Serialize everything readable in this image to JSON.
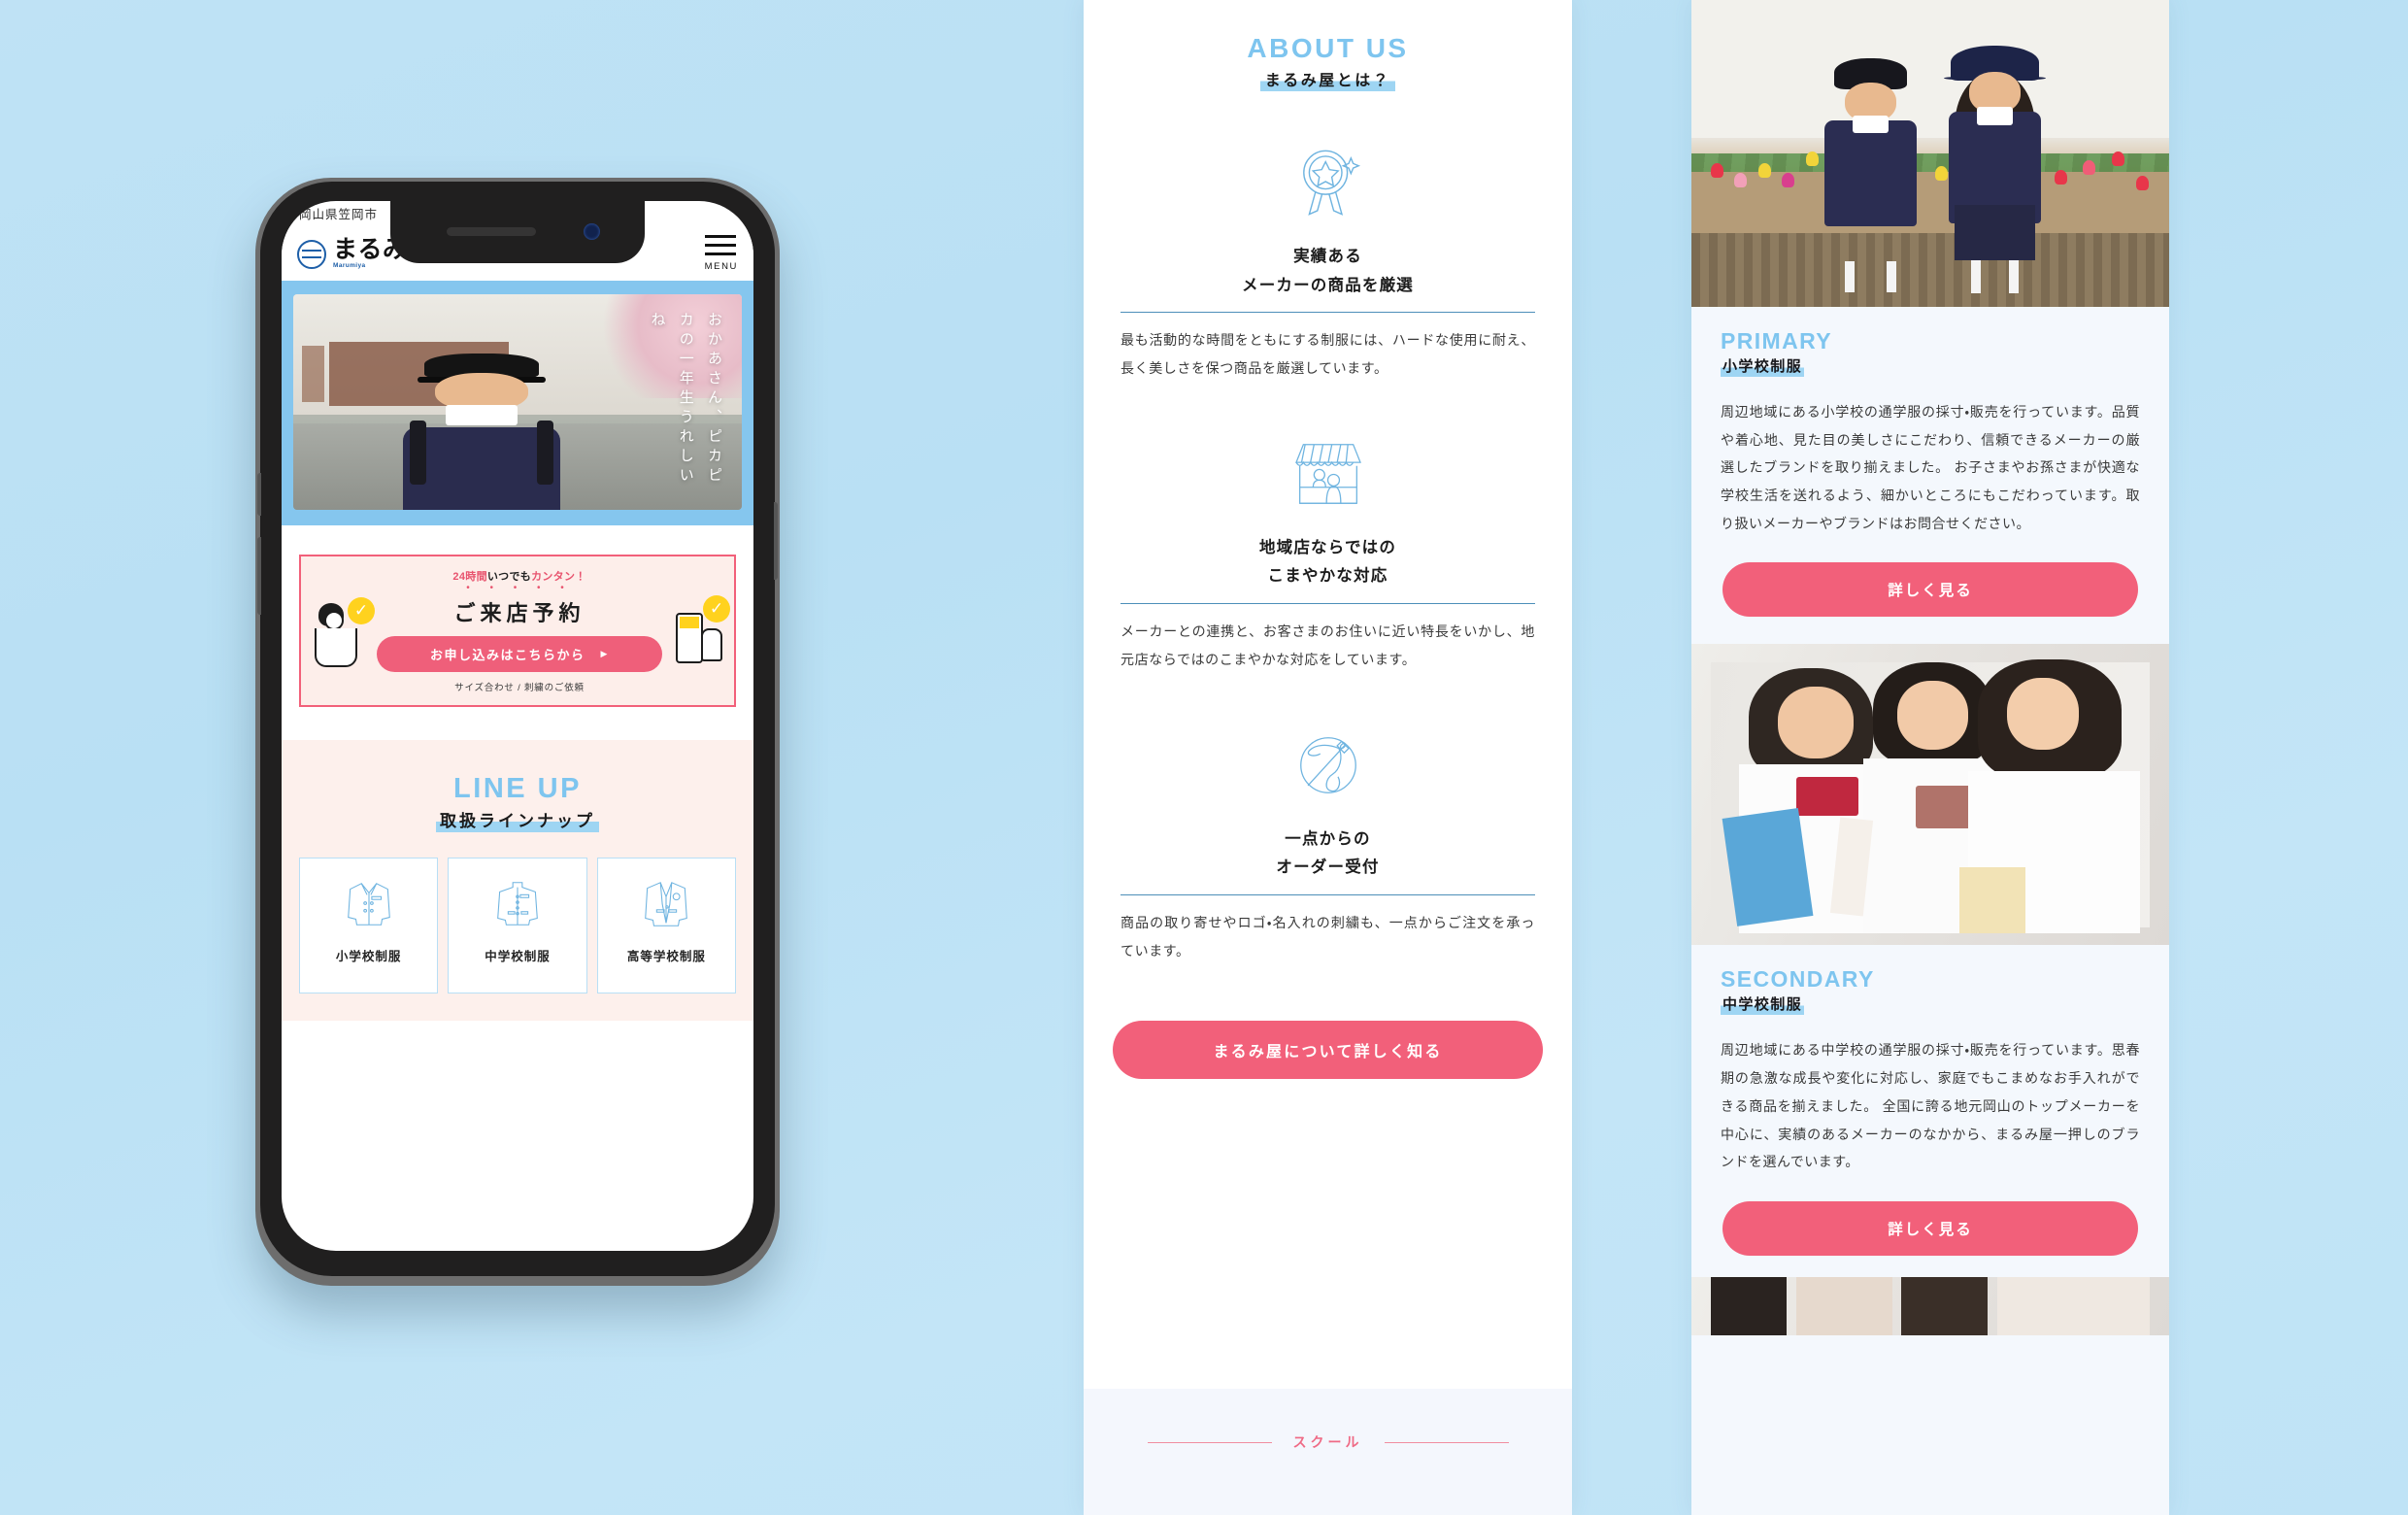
{
  "background_color": "#bfe2f5",
  "accent_pink": "#f2607a",
  "accent_blue": "#7ec5ef",
  "highlight_blue": "#9ed5f3",
  "phone": {
    "top_bar_text": "岡山県笠岡市",
    "logo_text": "まるみ屋",
    "logo_sub": "Marumiya",
    "menu_label": "MENU",
    "hero_vertical_text": "おかあさん、ピカピカの一年生うれしいね",
    "reserve": {
      "tag_prefix": "24",
      "tag_mid": "時間",
      "tag_after": "いつでも",
      "tag_accent": "カンタン！",
      "title": "ご来店予約",
      "button_label": "お申し込みはこちらから",
      "note": "サイズ合わせ / 刺繍のご依頼"
    },
    "lineup": {
      "en_title": "LINE UP",
      "jp_title": "取扱ラインナップ",
      "cards": [
        {
          "icon": "blazer-jacket-icon",
          "label": "小学校制服"
        },
        {
          "icon": "gakuran-jacket-icon",
          "label": "中学校制服"
        },
        {
          "icon": "suit-jacket-icon",
          "label": "高等学校制服"
        }
      ]
    }
  },
  "about": {
    "en_title": "ABOUT US",
    "jp_title": "まるみ屋とは？",
    "items": [
      {
        "icon": "award-ribbon-icon",
        "title_line1": "実績ある",
        "title_line2": "メーカーの商品を厳選",
        "body": "最も活動的な時間をともにする制服には、ハードな使用に耐え、長く美しさを保つ商品を厳選しています。"
      },
      {
        "icon": "storefront-icon",
        "title_line1": "地域店ならではの",
        "title_line2": "こまやかな対応",
        "body": "メーカーとの連携と、お客さまのお住いに近い特長をいかし、地元店ならではのこまやかな対応をしています。"
      },
      {
        "icon": "needle-thread-icon",
        "title_line1": "一点からの",
        "title_line2": "オーダー受付",
        "body": "商品の取り寄せやロゴ・名入れの刺繍も、一点からご注文を承っています。"
      }
    ],
    "cta_label": "まるみ屋について詳しく知る",
    "footer_label": "スクール"
  },
  "school": {
    "sections": [
      {
        "photo_alt": "primary-school-students-photo",
        "en_title": "PRIMARY",
        "jp_title": "小学校制服",
        "body": "周辺地域にある小学校の通学服の採寸・販売を行っています。品質や着心地、見た目の美しさにこだわり、信頼できるメーカーの厳選したブランドを取り揃えました。 お子さまやお孫さまが快適な学校生活を送れるよう、細かいところにもこだわっています。取り扱いメーカーやブランドはお問合せください。",
        "button_label": "詳しく見る"
      },
      {
        "photo_alt": "secondary-school-students-photo",
        "en_title": "SECONDARY",
        "jp_title": "中学校制服",
        "body": "周辺地域にある中学校の通学服の採寸・販売を行っています。思春期の急激な成長や変化に対応し、家庭でもこまめなお手入れができる商品を揃えました。 全国に誇る地元岡山のトップメーカーを中心に、実績のあるメーカーのなかから、まるみ屋一押しのブランドを選んでいます。",
        "button_label": "詳しく見る"
      },
      {
        "photo_alt": "high-school-students-photo",
        "en_title": "",
        "jp_title": "",
        "body": "",
        "button_label": ""
      }
    ]
  }
}
